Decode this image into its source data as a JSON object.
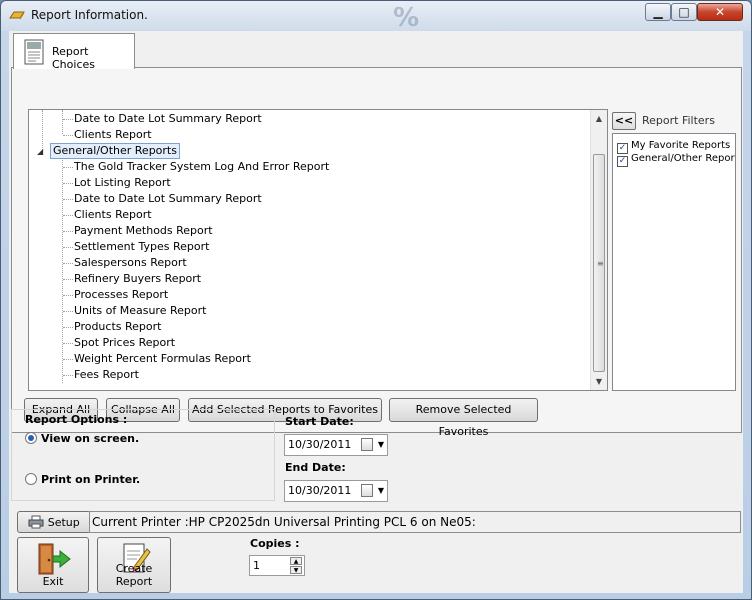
{
  "window": {
    "title": "Report Information.",
    "controls": {
      "minimize": "▁",
      "maximize": "□",
      "close": "✕"
    }
  },
  "tabs": [
    {
      "label": "Report Choices",
      "icon": "document-icon"
    }
  ],
  "tree": {
    "items": [
      {
        "label": "Date to Date Lot Summary Report",
        "level": 1
      },
      {
        "label": "Clients Report",
        "level": 1
      },
      {
        "label": "General/Other Reports",
        "level": 0,
        "expanded": true,
        "selected": true
      },
      {
        "label": "The Gold Tracker System Log And Error Report",
        "level": 1
      },
      {
        "label": "Lot Listing Report",
        "level": 1
      },
      {
        "label": "Date to Date Lot Summary Report",
        "level": 1
      },
      {
        "label": "Clients Report",
        "level": 1
      },
      {
        "label": "Payment Methods Report",
        "level": 1
      },
      {
        "label": "Settlement Types Report",
        "level": 1
      },
      {
        "label": "Salespersons Report",
        "level": 1
      },
      {
        "label": "Refinery Buyers Report",
        "level": 1
      },
      {
        "label": "Processes Report",
        "level": 1
      },
      {
        "label": "Units of Measure Report",
        "level": 1
      },
      {
        "label": "Products Report",
        "level": 1
      },
      {
        "label": "Spot Prices Report",
        "level": 1
      },
      {
        "label": "Weight Percent Formulas Report",
        "level": 1
      },
      {
        "label": "Fees Report",
        "level": 1
      }
    ]
  },
  "filters": {
    "collapse_label": "<<",
    "title": "Report Filters",
    "items": [
      {
        "label": "My Favorite Reports",
        "checked": true
      },
      {
        "label": "General/Other Reports",
        "checked": true
      }
    ]
  },
  "tree_buttons": {
    "expand_all": "Expand All",
    "collapse_all": "Collapse All",
    "add_favorites": "Add Selected Reports to Favorites",
    "remove_favorites": "Remove Selected Favorites"
  },
  "report_options": {
    "title": "Report Options :",
    "view_on_screen": "View on screen.",
    "print_on_printer": "Print on Printer.",
    "selected": "view_on_screen"
  },
  "dates": {
    "start_label": "Start Date:",
    "start_value": "10/30/2011",
    "end_label": "End Date:",
    "end_value": "10/30/2011"
  },
  "printer": {
    "setup_label": "Setup",
    "current": "Current Printer :HP CP2025dn Universal Printing PCL 6 on Ne05:"
  },
  "actions": {
    "exit_label": "Exit",
    "create_label": "Create Report",
    "copies_label": "Copies :",
    "copies_value": "1"
  },
  "colors": {
    "accent": "#2b5fb3",
    "selection": "#e3eefb",
    "close": "#c8442d"
  }
}
